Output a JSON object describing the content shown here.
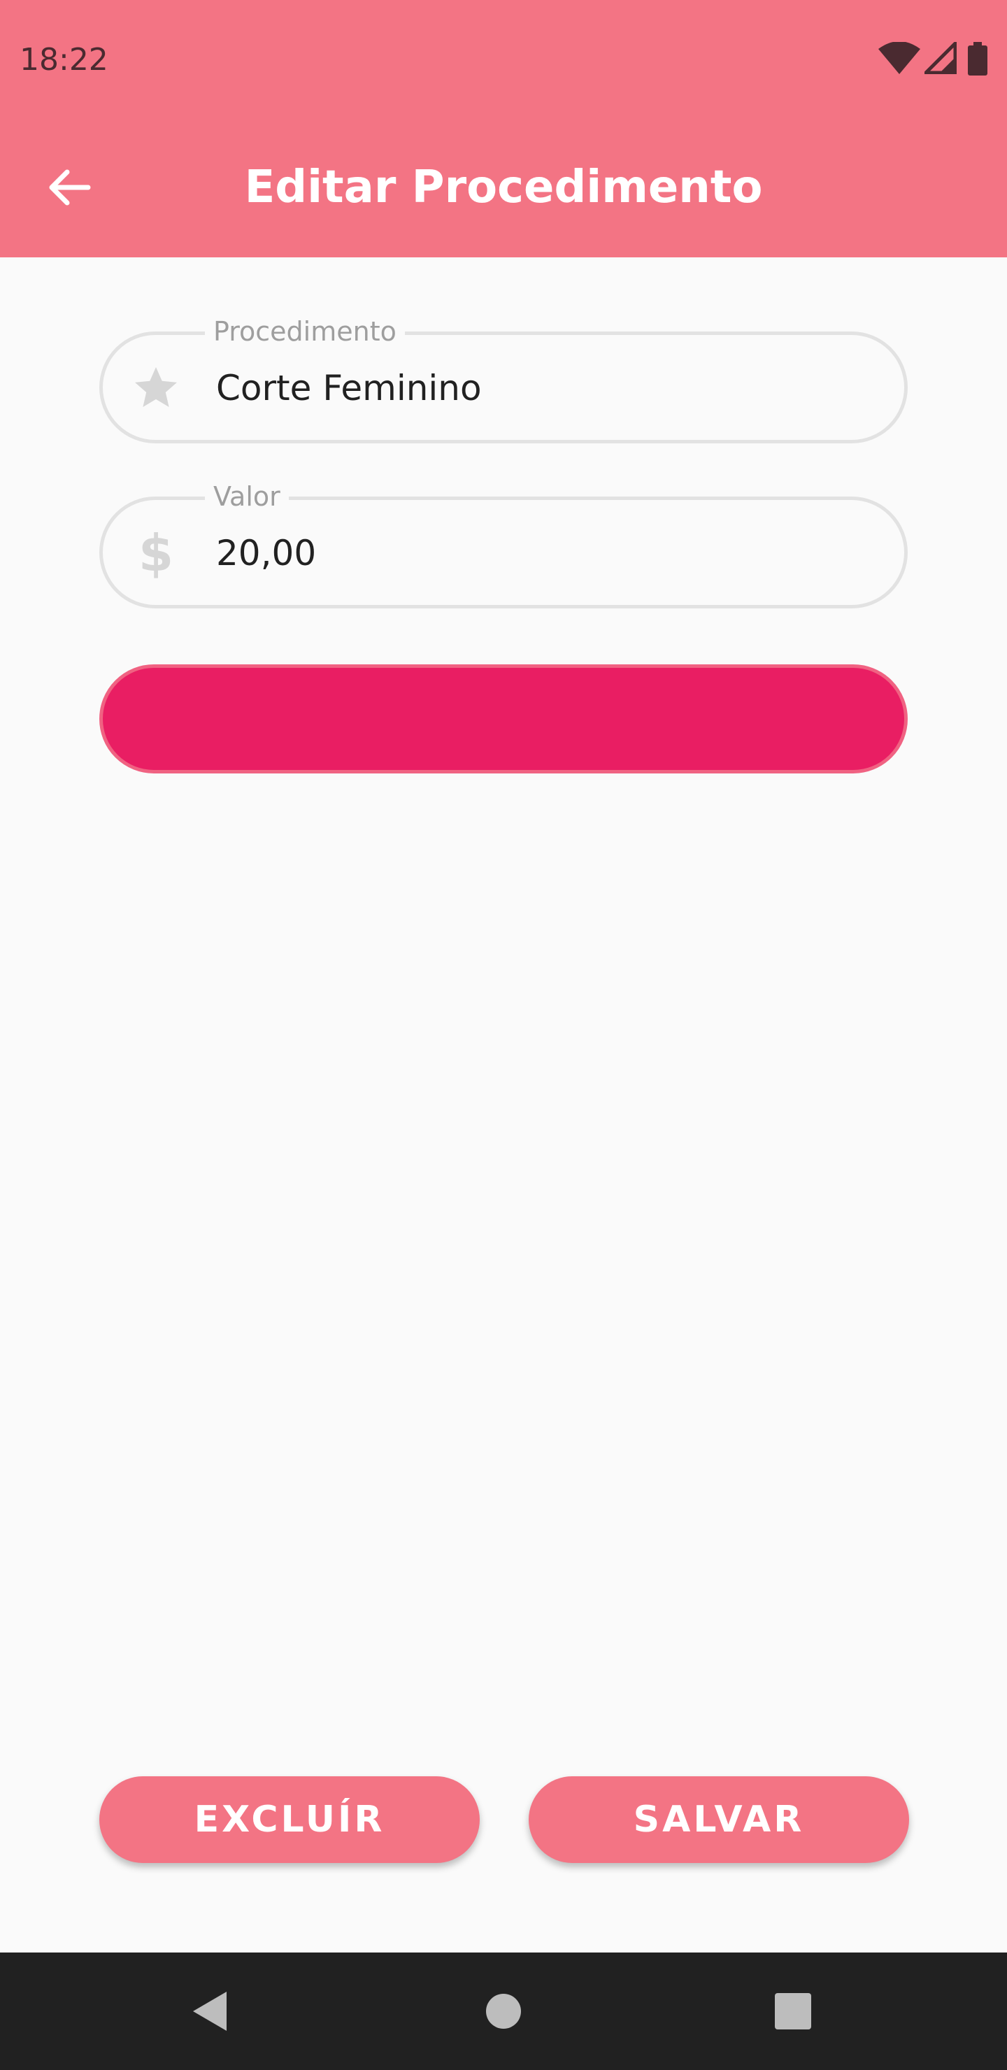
{
  "status_bar": {
    "time": "18:22",
    "icons": [
      "wifi-icon",
      "signal-icon",
      "battery-icon"
    ]
  },
  "app_bar": {
    "title": "Editar Procedimento",
    "back_icon": "arrow-left-icon"
  },
  "form": {
    "procedimento": {
      "label": "Procedimento",
      "value": "Corte Feminino",
      "icon": "star-icon"
    },
    "valor": {
      "label": "Valor",
      "value": "20,00",
      "icon": "$"
    },
    "color_selector": {
      "color": "#E91E63"
    }
  },
  "actions": {
    "delete_label": "EXCLUÍR",
    "save_label": "SALVAR"
  },
  "nav_bar": {
    "keys": [
      "back-triangle-icon",
      "home-circle-icon",
      "recents-square-icon"
    ]
  },
  "colors": {
    "primary": "#F37484",
    "accent": "#E91E63",
    "background": "#FAFAFA"
  }
}
